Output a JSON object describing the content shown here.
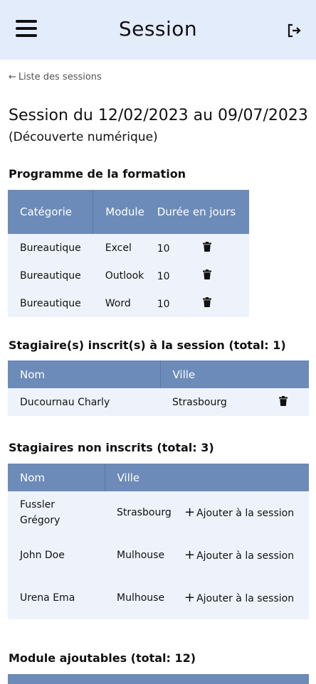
{
  "header": {
    "title": "Session",
    "menu_icon": "hamburger-icon",
    "logout_icon": "logout-icon"
  },
  "back_link": "Liste des sessions",
  "session": {
    "title": "Session du 12/02/2023 au 09/07/2023",
    "subtitle": "(Découverte numérique)"
  },
  "programme": {
    "title": "Programme de la formation",
    "columns": [
      "Catégorie",
      "Module",
      "Durée en jours"
    ],
    "rows": [
      {
        "categorie": "Bureautique",
        "module": "Excel",
        "duree": "10"
      },
      {
        "categorie": "Bureautique",
        "module": "Outlook",
        "duree": "10"
      },
      {
        "categorie": "Bureautique",
        "module": "Word",
        "duree": "10"
      }
    ]
  },
  "inscrits": {
    "title": "Stagiaire(s) inscrit(s) à la session (total: 1)",
    "columns": [
      "Nom",
      "Ville"
    ],
    "rows": [
      {
        "nom": "Ducournau Charly",
        "ville": "Strasbourg"
      }
    ]
  },
  "non_inscrits": {
    "title": "Stagiaires non inscrits (total: 3)",
    "columns": [
      "Nom",
      "Ville"
    ],
    "add_label": "Ajouter à la session",
    "rows": [
      {
        "nom": "Fussler Grégory",
        "ville": "Strasbourg"
      },
      {
        "nom": "John Doe",
        "ville": "Mulhouse"
      },
      {
        "nom": "Urena Ema",
        "ville": "Mulhouse"
      }
    ]
  },
  "modules_ajoutables": {
    "title": "Module ajoutables (total: 12)"
  },
  "colors": {
    "header_bg": "#e3ecfb",
    "table_head": "#6c8bb8",
    "row_bg": "#eef3fb"
  }
}
